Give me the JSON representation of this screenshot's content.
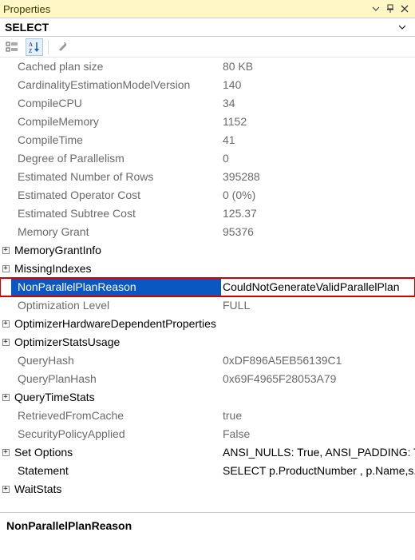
{
  "panel": {
    "title": "Properties",
    "object_name": "SELECT",
    "description_label": "NonParallelPlanReason"
  },
  "icons": {
    "categorized": "categorized-icon",
    "alphabetical": "alphabetical-icon",
    "propertypages": "wrench-icon",
    "dropdown": "chevron-down-icon",
    "pin": "pin-icon",
    "close": "close-icon",
    "expand": "plus-box-icon"
  },
  "rows": [
    {
      "name": "Cached plan size",
      "value": "80 KB",
      "expandable": false,
      "dim": true
    },
    {
      "name": "CardinalityEstimationModelVersion",
      "value": "140",
      "expandable": false,
      "dim": true
    },
    {
      "name": "CompileCPU",
      "value": "34",
      "expandable": false,
      "dim": true
    },
    {
      "name": "CompileMemory",
      "value": "1152",
      "expandable": false,
      "dim": true
    },
    {
      "name": "CompileTime",
      "value": "41",
      "expandable": false,
      "dim": true
    },
    {
      "name": "Degree of Parallelism",
      "value": "0",
      "expandable": false,
      "dim": true
    },
    {
      "name": "Estimated Number of Rows",
      "value": "395288",
      "expandable": false,
      "dim": true
    },
    {
      "name": "Estimated Operator Cost",
      "value": "0 (0%)",
      "expandable": false,
      "dim": true
    },
    {
      "name": "Estimated Subtree Cost",
      "value": "125.37",
      "expandable": false,
      "dim": true
    },
    {
      "name": "Memory Grant",
      "value": "95376",
      "expandable": false,
      "dim": true
    },
    {
      "name": "MemoryGrantInfo",
      "value": "",
      "expandable": true,
      "dim": false
    },
    {
      "name": "MissingIndexes",
      "value": "",
      "expandable": true,
      "dim": false
    },
    {
      "name": "NonParallelPlanReason",
      "value": "CouldNotGenerateValidParallelPlan",
      "expandable": false,
      "dim": false,
      "selected": true,
      "highlight": true
    },
    {
      "name": "Optimization Level",
      "value": "FULL",
      "expandable": false,
      "dim": true
    },
    {
      "name": "OptimizerHardwareDependentProperties",
      "value": "",
      "expandable": true,
      "dim": false
    },
    {
      "name": "OptimizerStatsUsage",
      "value": "",
      "expandable": true,
      "dim": false
    },
    {
      "name": "QueryHash",
      "value": "0xDF896A5EB56139C1",
      "expandable": false,
      "dim": true
    },
    {
      "name": "QueryPlanHash",
      "value": "0x69F4965F28053A79",
      "expandable": false,
      "dim": true
    },
    {
      "name": "QueryTimeStats",
      "value": "",
      "expandable": true,
      "dim": false
    },
    {
      "name": "RetrievedFromCache",
      "value": "true",
      "expandable": false,
      "dim": true
    },
    {
      "name": "SecurityPolicyApplied",
      "value": "False",
      "expandable": false,
      "dim": true
    },
    {
      "name": "Set Options",
      "value": "ANSI_NULLS: True, ANSI_PADDING: True,",
      "expandable": true,
      "dim": false
    },
    {
      "name": "Statement",
      "value": "SELECT    p.ProductNumber , p.Name,s.C",
      "expandable": false,
      "dim": false
    },
    {
      "name": "WaitStats",
      "value": "",
      "expandable": true,
      "dim": false
    }
  ]
}
